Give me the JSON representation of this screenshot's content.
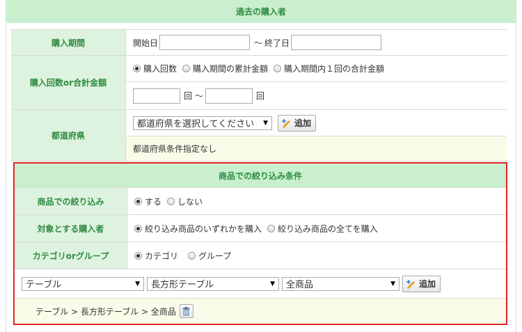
{
  "header": {
    "title": "過去の購入者"
  },
  "purchase_period": {
    "label": "購入期間",
    "start_label": "開始日",
    "tilde": "～",
    "end_label": "終了日",
    "start_value": "",
    "end_value": ""
  },
  "purchase_count": {
    "label": "購入回数or合計金額",
    "options": [
      "購入回数",
      "購入期間の累計金額",
      "購入期間内１回の合計金額"
    ],
    "selected_index": 0,
    "from_value": "",
    "to_value": "",
    "unit1": "回",
    "tilde": "～",
    "unit2": "回"
  },
  "prefecture": {
    "label": "都道府県",
    "select_value": "都道府県を選択してください",
    "add_label": "追加",
    "note": "都道府県条件指定なし"
  },
  "product_filter": {
    "header": "商品での絞り込み条件",
    "filter_label": "商品での絞り込み",
    "filter_options": [
      "する",
      "しない"
    ],
    "filter_selected": 0,
    "buyer_label": "対象とする購入者",
    "buyer_options": [
      "絞り込み商品のいずれかを購入",
      "絞り込み商品の全てを購入"
    ],
    "buyer_selected": 0,
    "cat_label": "カテゴリorグループ",
    "cat_options": [
      "カテゴリ",
      "グループ"
    ],
    "cat_selected": 0,
    "select1": "テーブル",
    "select2": "長方形テーブル",
    "select3": "全商品",
    "add_label": "追加",
    "path": "テーブル > 長方形テーブル > 全商品"
  }
}
